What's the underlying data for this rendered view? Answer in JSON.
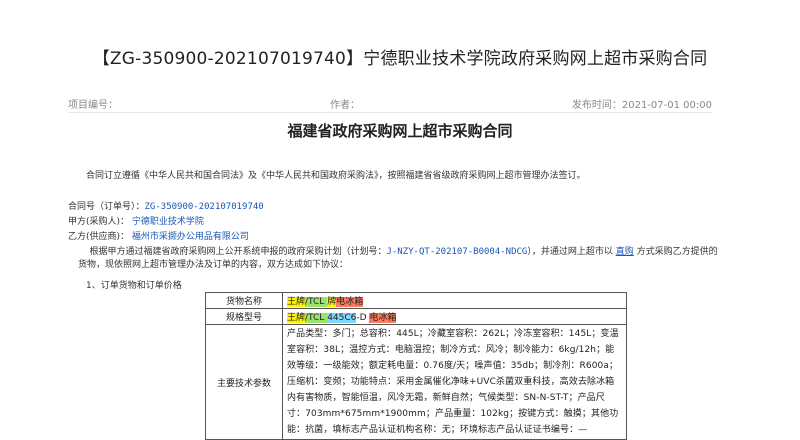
{
  "page": {
    "title": "【ZG-350900-202107019740】宁德职业技术学院政府采购网上超市采购合同"
  },
  "meta": {
    "project_no_label": "项目编号：",
    "author_label": "作者：",
    "publish_time": "发布时间：2021-07-01 00:00"
  },
  "document": {
    "title": "福建省政府采购网上超市采购合同",
    "intro": "合同订立遵循《中华人民共和国合同法》及《中华人民共和国政府采购法》，按照福建省省级政府采购网上超市管理办法签订。",
    "contract_no_label": "合同号（订单号）：",
    "contract_no": "ZG-350900-202107019740",
    "party_a_label": "甲方(采购人)：",
    "party_a": "宁德职业技术学院",
    "party_b_label": "乙方(供应商)：",
    "party_b": "福州市采撷办公用品有限公司",
    "basis_prefix": "根据甲方通过福建省政府采购网上公开系统申报的政府采购计划（计划号：",
    "plan_no": "J-NZY-QT-202107-B0004-NDCG",
    "basis_middle": "），并通过网上超市以",
    "basis_link": "直购",
    "basis_suffix": "方式采购乙方提供的货物，现依照网上超市管理办法及订单的内容，双方达成如下协议：",
    "section1": "1、订单货物和订单价格"
  },
  "spec_table": {
    "goods_name_label": "货物名称",
    "goods_name_parts": [
      "王牌",
      "/TCL ",
      "牌",
      "电冰箱"
    ],
    "model_label": "规格型号",
    "model_parts": [
      "王牌",
      "/TCL ",
      "445C6",
      "-D ",
      "电冰箱"
    ],
    "params_label": "主要技术参数",
    "params": "产品类型：多门；总容积：445L；冷藏室容积：262L；冷冻室容积：145L；变温室容积：38L；温控方式：电脑温控；制冷方式：风冷；制冷能力：6kg/12h；能效等级：一级能效；额定耗电量：0.76度/天；噪声值：35db；制冷剂：R600a；压缩机：变频；功能特点：采用金属催化净味+UVC杀菌双重科技，高效去除冰箱内有害物质，智能恒温，风冷无霜，新鲜自然；气候类型：SN-N-ST-T；产品尺寸：703mm*675mm*1900mm；产品重量：102kg；按键方式：触摸；其他功能：抗菌，填标志产品认证机构名称：无；环境标志产品认证证书编号：—"
  },
  "colors": {
    "link": "#1a56b8",
    "highlight_yellow": "#fff200",
    "highlight_green": "#9be36b",
    "highlight_red": "#ff7a5c",
    "highlight_cyan": "#7fd8ff"
  }
}
